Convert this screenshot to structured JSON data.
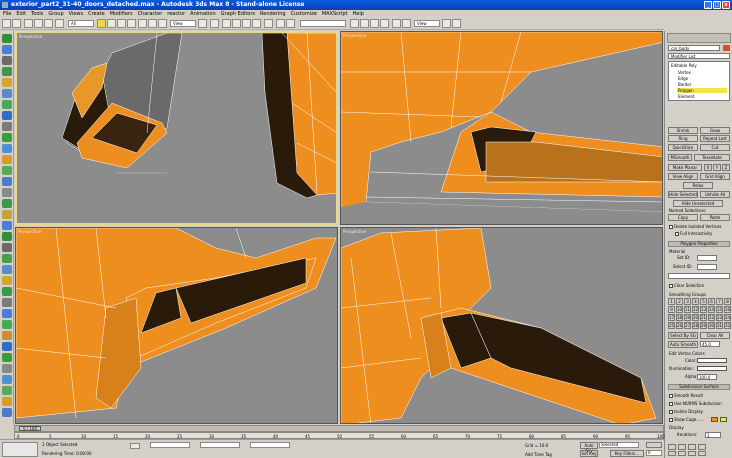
{
  "window": {
    "title": "exterior_part2_31-40_doors_detached.max - Autodesk 3ds Max 8 - Stand-alone License",
    "min": "_",
    "max": "□",
    "close": "x"
  },
  "menu": [
    "File",
    "Edit",
    "Tools",
    "Group",
    "Views",
    "Create",
    "Modifiers",
    "Character",
    "reactor",
    "Animation",
    "Graph Editors",
    "Rendering",
    "Customize",
    "MAXScript",
    "Help"
  ],
  "toolbar": {
    "selection_filter": "All",
    "ref_coord": "View",
    "named_sel": "",
    "view_dropdown": "View"
  },
  "viewports": {
    "top_left": "Perspective",
    "top_right": "Perspective",
    "bottom_left": "Perspective",
    "bottom_right": "Perspective"
  },
  "command_panel": {
    "object_name": "car_body",
    "modifier_list": "Modifier List",
    "stack": [
      "Editable Poly",
      "Vertex",
      "Edge",
      "Border",
      "Polygon",
      "Element"
    ],
    "stack_selected": "Polygon",
    "buttons": {
      "shrink": "Shrink",
      "ring": "Ring",
      "loop": "Loop",
      "shrink2": "Shrink",
      "grow": "Grow",
      "repeat_last": "Repeat Last",
      "quickslice": "QuickSlice",
      "cut": "Cut",
      "msmooth": "MSmooth",
      "tessellate": "Tessellate",
      "make_planar": "Make Planar",
      "x": "X",
      "y": "Y",
      "z": "Z",
      "view_align": "View Align",
      "grid_align": "Grid Align",
      "relax": "Relax",
      "hide_selected": "Hide Selected",
      "unhide_all": "Unhide All",
      "hide_unselected": "Hide Unselected",
      "named_selections": "Named Selections:",
      "copy": "Copy",
      "paste": "Paste",
      "delete_isolated": "Delete Isolated Vertices",
      "full_interactivity": "Full Interactivity"
    },
    "polygon_properties": {
      "title": "Polygon Properties",
      "material": "Material",
      "set_id": "Set ID:",
      "select_id": "Select ID:",
      "clear_selection": "Clear Selection",
      "smoothing_groups": "Smoothing Groups",
      "sg": [
        "1",
        "2",
        "3",
        "4",
        "5",
        "6",
        "7",
        "8",
        "9",
        "10",
        "11",
        "12",
        "13",
        "14",
        "15",
        "16",
        "17",
        "18",
        "19",
        "20",
        "21",
        "22",
        "23",
        "24",
        "25",
        "26",
        "27",
        "28",
        "29",
        "30",
        "31",
        "32"
      ],
      "select_by_sg": "Select By SG",
      "clear_all": "Clear All",
      "auto_smooth": "Auto Smooth",
      "auto_smooth_value": "45.0"
    },
    "edit_vertex_colors": {
      "title": "Edit Vertex Colors",
      "color": "Color:",
      "illumination": "Illumination:",
      "alpha": "Alpha:",
      "alpha_value": "100.0"
    },
    "subdivision": {
      "title": "Subdivision Surface",
      "smooth_result": "Smooth Result",
      "use_nurms": "Use NURMS Subdivision",
      "isoline": "Isoline Display",
      "show_cage": "Show Cage......",
      "display": "Display",
      "iterations": "Iterations:",
      "iterations_value": "1"
    }
  },
  "timeline": {
    "frame": "0 / 100",
    "ticks": [
      "0",
      "5",
      "10",
      "15",
      "20",
      "25",
      "30",
      "35",
      "40",
      "45",
      "50",
      "55",
      "60",
      "65",
      "70",
      "75",
      "80",
      "85",
      "90",
      "95",
      "100"
    ]
  },
  "status": {
    "selected": "1 Object Selected",
    "rendering_time": "Rendering Time: 0:00:00",
    "grid": "Grid = 10.0",
    "add_time_tag": "Add Time Tag",
    "auto_key": "Auto Key",
    "set_key": "Set Key",
    "key_mode": "Selected",
    "key_filters": "Key Filters...",
    "frame_field": "0"
  },
  "colors": {
    "orange": "#ee8e1e",
    "viewport_bg": "#8c8c8c",
    "active_border": "#e8d88a",
    "polygon_highlight": "#f4e44a"
  }
}
